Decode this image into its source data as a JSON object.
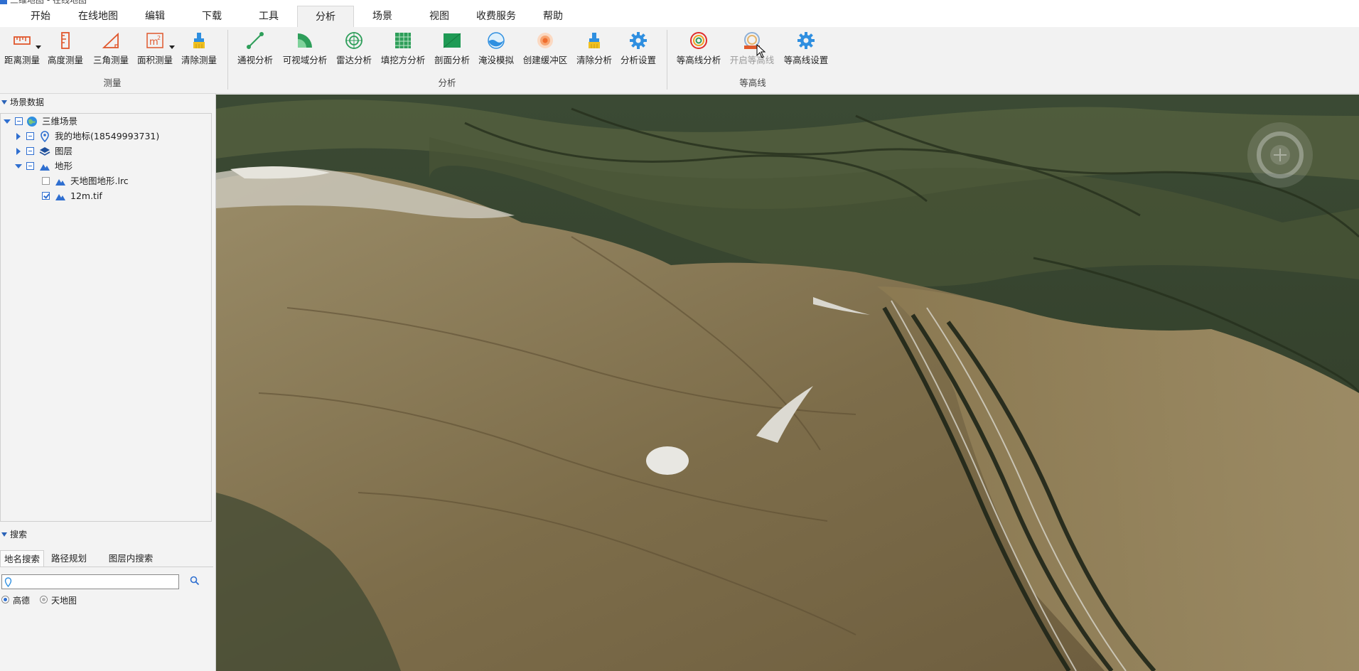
{
  "app": {
    "title": "三维地图 - 在线地图"
  },
  "menu": {
    "items": [
      "开始",
      "在线地图",
      "编辑",
      "下载",
      "工具",
      "分析",
      "场景",
      "视图",
      "收费服务",
      "帮助"
    ],
    "active": "分析"
  },
  "ribbon": {
    "measure": {
      "group_label": "测量",
      "buttons": [
        {
          "label": "距离测量",
          "icon": "distance-ruler-icon"
        },
        {
          "label": "高度测量",
          "icon": "height-ruler-icon"
        },
        {
          "label": "三角测量",
          "icon": "triangle-icon"
        },
        {
          "label": "面积测量",
          "icon": "area-m2-icon"
        },
        {
          "label": "清除测量",
          "icon": "brush-icon"
        }
      ]
    },
    "analysis": {
      "group_label": "分析",
      "buttons": [
        {
          "label": "通视分析",
          "icon": "line-of-sight-icon"
        },
        {
          "label": "可视域分析",
          "icon": "viewshed-icon"
        },
        {
          "label": "雷达分析",
          "icon": "radar-icon"
        },
        {
          "label": "填挖方分析",
          "icon": "cut-fill-grid-icon"
        },
        {
          "label": "剖面分析",
          "icon": "profile-icon"
        },
        {
          "label": "淹没模拟",
          "icon": "flood-icon"
        },
        {
          "label": "创建缓冲区",
          "icon": "buffer-icon"
        },
        {
          "label": "清除分析",
          "icon": "brush-icon"
        },
        {
          "label": "分析设置",
          "icon": "gear-icon"
        }
      ]
    },
    "contour": {
      "group_label": "等高线",
      "buttons": [
        {
          "label": "等高线分析",
          "icon": "contour-icon"
        },
        {
          "label": "开启等高线",
          "icon": "contour-toggle-icon",
          "disabled": true
        },
        {
          "label": "等高线设置",
          "icon": "gear-icon"
        }
      ]
    }
  },
  "scene_panel": {
    "title": "场景数据",
    "tree": {
      "root": "三维场景",
      "children": [
        {
          "label": "我的地标(18549993731)",
          "icon": "placemark-icon"
        },
        {
          "label": "图层",
          "icon": "layers-icon"
        },
        {
          "label": "地形",
          "icon": "terrain-icon",
          "children": [
            {
              "label": "天地图地形.lrc",
              "checked": false
            },
            {
              "label": "12m.tif",
              "checked": true
            }
          ]
        }
      ]
    }
  },
  "search_panel": {
    "title": "搜索",
    "tabs": [
      "地名搜索",
      "路径规划",
      "图层内搜索"
    ],
    "active_tab": "地名搜索",
    "input_value": "",
    "input_placeholder": "",
    "sources": [
      {
        "label": "高德",
        "selected": true
      },
      {
        "label": "天地图",
        "selected": false
      }
    ]
  },
  "colors": {
    "accent": "#2f6fd0",
    "ribbon_bg": "#f2f2f2",
    "terrain_slope": "#8a7b58",
    "terrain_forest": "#3d4a2c"
  }
}
